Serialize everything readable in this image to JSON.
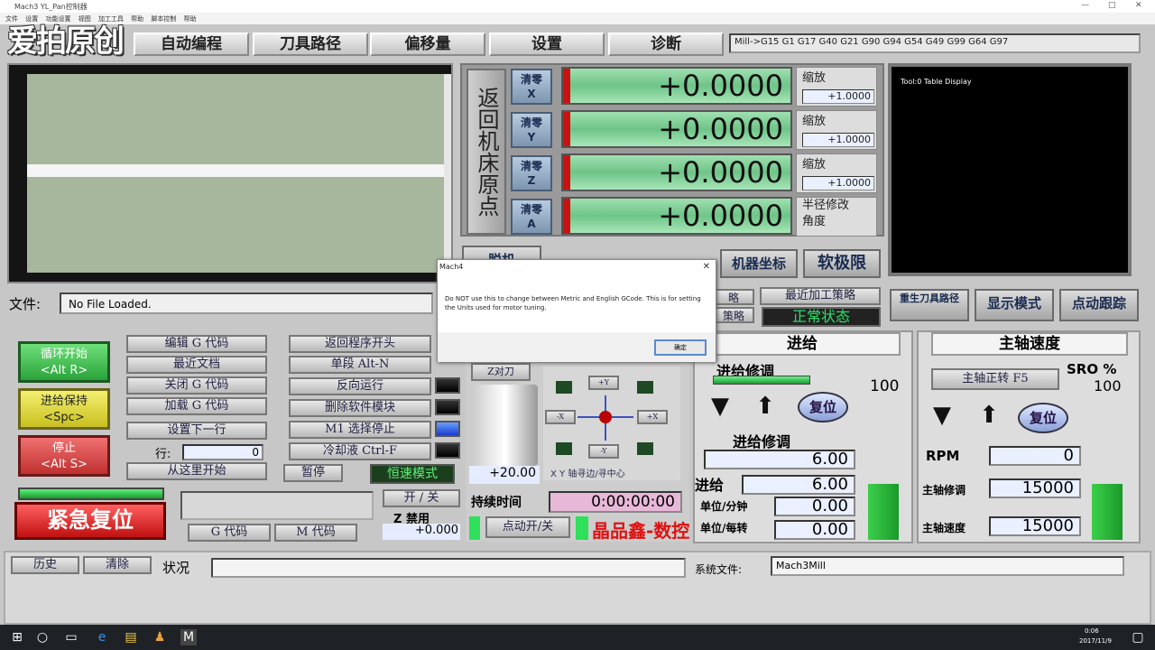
{
  "window": {
    "title": "Mach3 YL_Pan控制器",
    "min": "—",
    "max": "□",
    "close": "✕"
  },
  "menu": [
    "文件",
    "设置",
    "功能设置",
    "视图",
    "加工工具",
    "帮助",
    "脚本控制",
    "帮助"
  ],
  "logo": "爱拍原创",
  "tabs": [
    "自动编程",
    "刀具路径",
    "偏移量",
    "设置",
    "诊断"
  ],
  "gcode_line": "Mill->G15  G1 G17 G40 G21 G90 G94 G54 G49 G99 G64 G97",
  "ref_all": "返回机床原点",
  "axes": [
    {
      "zero": "清零\nX",
      "value": "+0.0000",
      "scale_label": "缩放",
      "scale_value": "+1.0000"
    },
    {
      "zero": "清零\nY",
      "value": "+0.0000",
      "scale_label": "缩放",
      "scale_value": "+1.0000"
    },
    {
      "zero": "清零\nZ",
      "value": "+0.0000",
      "scale_label": "缩放",
      "scale_value": "+1.0000"
    },
    {
      "zero": "清零\nA",
      "value": "+0.0000",
      "scale_label": "半径修改\n角度",
      "scale_value": ""
    }
  ],
  "tool_display": "Tool:0   Table Display",
  "dro_buttons": {
    "machine_coords": "机器坐标",
    "soft_limits": "软极限",
    "partial_a": "脱机"
  },
  "file": {
    "label": "文件:",
    "value": "No File Loaded."
  },
  "right_buttons": {
    "recent_strategy": "最近加工策略",
    "strategy": "策略",
    "normal_status": "正常状态",
    "regen_toolpath": "重生刀具路径",
    "display_mode": "显示模式",
    "jog_follow": "点动跟踪",
    "partial_lue": "略"
  },
  "left_controls": {
    "cycle_start": "循环开始\n<Alt R>",
    "feed_hold": "进给保持\n<Spc>",
    "stop": "停止\n<Alt S>",
    "edit_gcode": "编辑 G 代码",
    "recent_file": "最近文档",
    "close_gcode": "关闭 G 代码",
    "load_gcode": "加载 G 代码",
    "set_next_line": "设置下一行",
    "line_label": "行:",
    "line_value": "0",
    "run_from_here": "从这里开始",
    "rewind": "返回程序开头",
    "single_block": "单段 Alt-N",
    "reverse_run": "反向运行",
    "block_delete": "删除软件模块",
    "m1_optional": "M1 选择停止",
    "coolant": "冷却液 Ctrl-F",
    "pause": "暂停",
    "css_mode": "恒速模式"
  },
  "emergency": "紧急复位",
  "bottom_left": {
    "toggle": "开 / 关",
    "gcodes": "G 代码",
    "mcodes": "M 代码",
    "z_inhibit": "Z 禁用",
    "z_value": "+0.000"
  },
  "jog": {
    "z_tool": "Z对刀",
    "z_value": "+20.00",
    "plus_y": "+Y",
    "minus_y": "-Y",
    "minus_x": "-X",
    "plus_x": "+X",
    "xy_label": "X Y 轴寻边/寻中心",
    "elapsed_label": "持续时间",
    "elapsed": "0:00:00:00",
    "jog_toggle": "点动开/关",
    "brand": "晶品鑫-数控"
  },
  "feed": {
    "title": "进给",
    "override": "进给修调",
    "reset": "复位",
    "ovr_value": "100",
    "fro_label": "进给修调",
    "fro": "6.00",
    "feed_label": "进给",
    "feed": "6.00",
    "upm_label": "单位/分钟",
    "upm": "0.00",
    "upr_label": "单位/每转",
    "upr": "0.00"
  },
  "spindle": {
    "title": "主轴速度",
    "cw": "主轴正转 F5",
    "sro_label": "SRO %",
    "sro": "100",
    "reset": "复位",
    "rpm_label": "RPM",
    "rpm": "0",
    "override_label": "主轴修调",
    "override": "15000",
    "speed_label": "主轴速度",
    "speed": "15000"
  },
  "status": {
    "history": "历史",
    "clear": "清除",
    "label": "状况",
    "profile_label": "系统文件:",
    "profile": "Mach3Mill"
  },
  "dialog": {
    "title": "Mach4",
    "close": "✕",
    "message": "Do NOT use this to change between Metric and English GCode. This is for setting the Units used for motor tuning.",
    "ok": "确定"
  },
  "taskbar": {
    "time": "0:06",
    "date": "2017/11/9"
  },
  "colors": {
    "dro_green": "#7fd397",
    "zero_blue": "#8aa3c2",
    "emergency_red": "#e02020"
  }
}
